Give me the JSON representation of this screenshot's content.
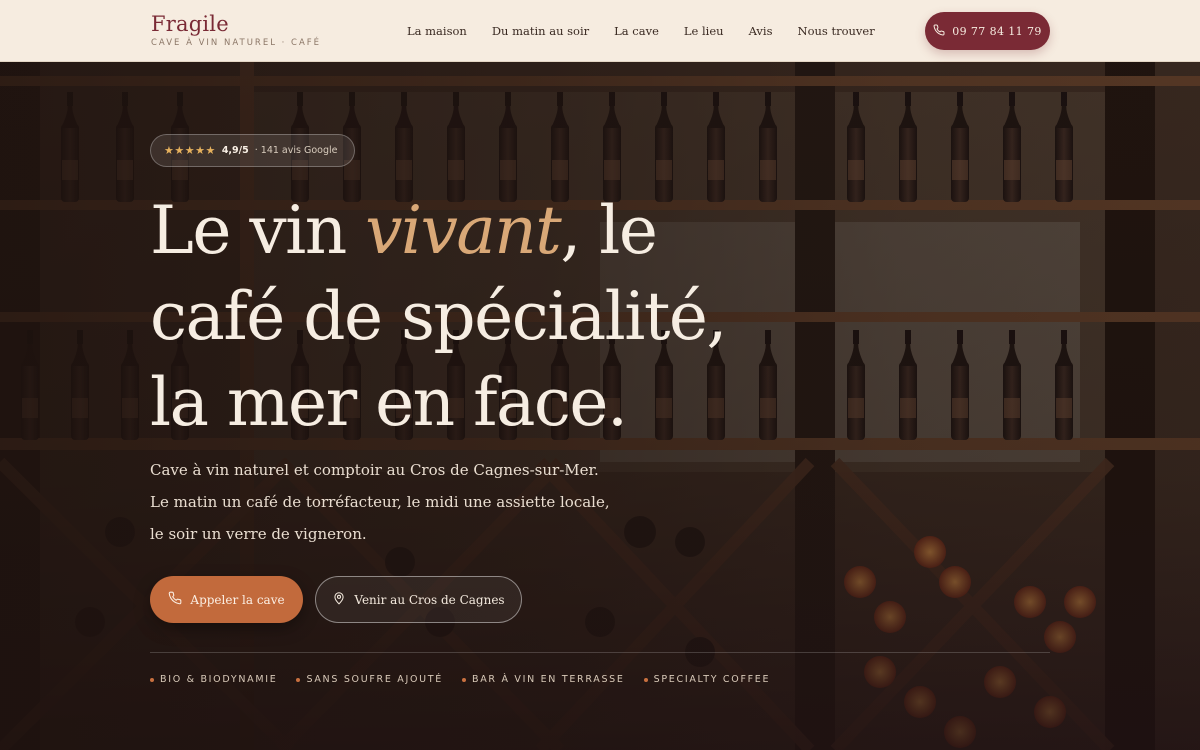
{
  "brand": {
    "name": "Fragile",
    "tagline": "CAVE À VIN NATUREL · CAFÉ"
  },
  "nav": {
    "items": [
      {
        "label": "La maison"
      },
      {
        "label": "Du matin au soir"
      },
      {
        "label": "La cave"
      },
      {
        "label": "Le lieu"
      },
      {
        "label": "Avis"
      },
      {
        "label": "Nous trouver"
      }
    ]
  },
  "header": {
    "phone_label": "09 77 84 11 79"
  },
  "hero": {
    "rating": {
      "stars": "★★★★★",
      "score": "4,9/5",
      "count": "· 141 avis Google"
    },
    "headline": {
      "line1_start": "Le vin ",
      "line1_accent": "vivant",
      "line1_end": ", le",
      "line2": "café de spécialité,",
      "line3": "la mer en face."
    },
    "lede": {
      "line1": "Cave à vin naturel et comptoir au Cros de Cagnes-sur-Mer.",
      "line2": "Le matin un café de torréfacteur, le midi une assiette locale,",
      "line3": "le soir un verre de vigneron."
    },
    "cta_primary": "Appeler la cave",
    "cta_secondary": "Venir au Cros de Cagnes",
    "tags": [
      {
        "label": "BIO & BIODYNAMIE"
      },
      {
        "label": "SANS SOUFRE AJOUTÉ"
      },
      {
        "label": "BAR À VIN EN TERRASSE"
      },
      {
        "label": "SPECIALTY COFFEE"
      }
    ]
  },
  "colors": {
    "brand_burgundy": "#7a2a35",
    "header_cream": "#f6ece0",
    "accent_copper": "#c26a3c",
    "accent_italic": "#d9a877",
    "star_gold": "#e7b25e"
  }
}
